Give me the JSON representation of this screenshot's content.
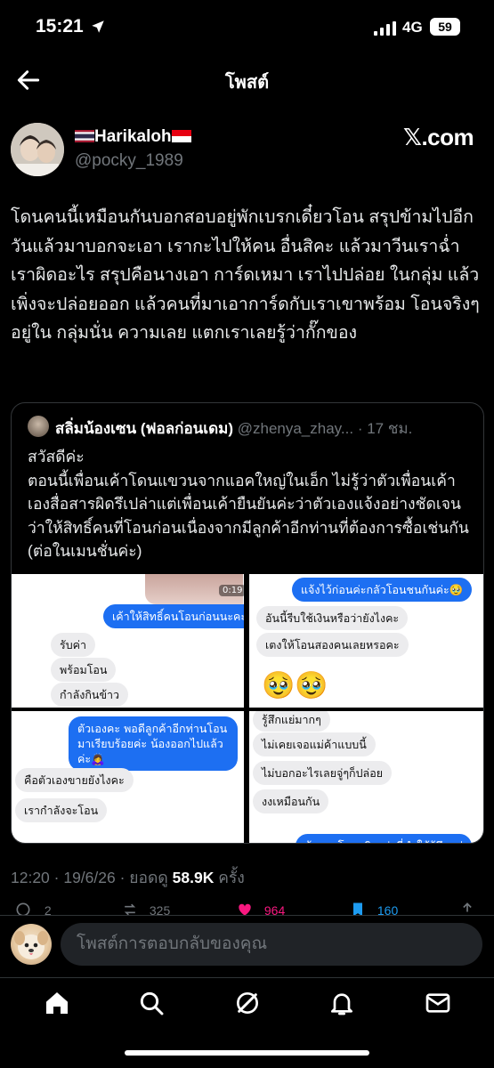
{
  "status_bar": {
    "time": "15:21",
    "network": "4G",
    "battery": "59"
  },
  "header": {
    "title": "โพสต์"
  },
  "author": {
    "name": "Harikaloh",
    "handle": "@pocky_1989",
    "watermark": "𝕏.com"
  },
  "post": {
    "text": "โดนคนนี้เหมือนกันบอกสอบอยู่พักเบรกเดี๋ยวโอน สรุปข้ามไปอีกวันแล้วมาบอกจะเอา เรากะไปให้คน อื่นสิคะ แล้วมาวีนเราฉ่ำ เราผิดอะไร สรุปคือนางเอา การ์ดเหมา เราไปปล่อย ในกลุ่ม แล้วเพิ่งจะปล่อยออก แล้วคนที่มาเอาการ์ดกับเราเขาพร้อม โอนจริงๆอยู่ใน กลุ่มนั่น ความเลย แตกเราเลยรู้ว่ากั๊กของ"
  },
  "quote": {
    "name": "สลิ่มน้องเซน (ฟอลก่อนเดม)",
    "handle": "@zhenya_zhay...",
    "time": "· 17 ชม.",
    "text": "สวัสดีค่ะ\nตอนนี้เพื่อนเค้าโดนแขวนจากแอคใหญ่ในเอ็ก ไม่รู้ว่าตัวเพื่อนเค้าเองสื่อสารผิดรึเปล่าแต่เพื่อนเค้ายืนยันค่ะว่าตัวเองแจ้งอย่างชัดเจนว่าให้สิทธิ์คนที่โอนก่อนเนื่องจากมีลูกค้าอีกท่านที่ต้องการซื้อเช่นกัน (ต่อในเมนชั่นค่ะ)",
    "chat1": {
      "duration": "0:19",
      "blue": "เค้าให้สิทธิ์คนโอนก่อนนะคะ❤️",
      "gray": [
        "รับค่า",
        "พร้อมโอน",
        "กำลังกินข้าว"
      ]
    },
    "chat2": {
      "blue": "แจ้งไว้ก่อนค่ะกลัวโอนชนกันค่ะ🥹",
      "gray": [
        "อันนี้รีบใช้เงินหรือว่ายังไงคะ",
        "เตงให้โอนสองคนเลยหรอคะ"
      ],
      "emoji": "🥹🥹"
    },
    "chat3": {
      "blue": "ตัวเองคะ พอดีลูกค้าอีกท่านโอนมาเรียบร้อยค่ะ น้องออกไปแล้วค่ะ🙇‍♀️",
      "gray": [
        "คือตัวเองขายยังไงคะ",
        "เรากำลังจะโอน"
      ]
    },
    "chat4": {
      "gray": [
        "รู้สึกแย่มากๆ",
        "ไม่เคยเจอแม่ค้าแบบนี้",
        "ไม่บอกอะไรเลยจู่ๆก็ปล่อย",
        "งงเหมือนกัน"
      ],
      "blue": "ต้องขอโทษจริงๆค่ะที่ทำให้รู้สึกแย่"
    }
  },
  "meta": {
    "time": "12:20 · 19/6/26 · ยอดดู ",
    "views": "58.9K",
    "views_suffix": " ครั้ง"
  },
  "actions": {
    "replies": "2",
    "reposts": "325",
    "likes": "964",
    "bookmarks": "160"
  },
  "reply": {
    "placeholder": "โพสต์การตอบกลับของคุณ"
  },
  "colors": {
    "background": "#000000",
    "accent": "#1d9bf0",
    "like": "#f91880",
    "muted": "#71767b"
  }
}
